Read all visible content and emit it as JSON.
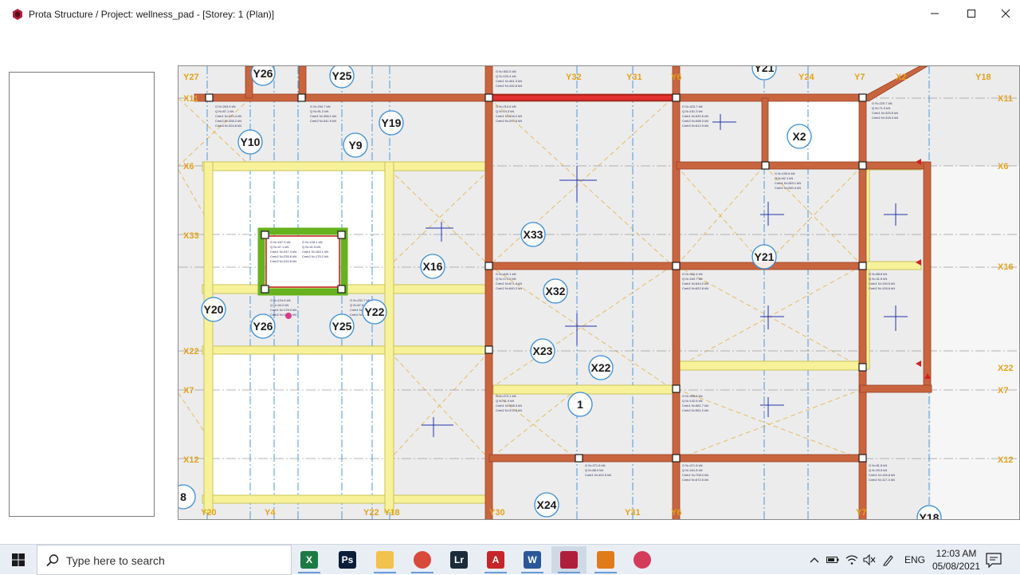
{
  "window": {
    "title": "Prota Structure / Project: wellness_pad - [Storey: 1 (Plan)]",
    "app_icon": "prota-structure-icon",
    "buttons": {
      "minimize": "minimize-icon",
      "maximize": "maximize-icon",
      "close": "close-icon"
    }
  },
  "plan": {
    "grid_labels": {
      "top": [
        "Y27",
        "Y24",
        "Y32",
        "Y31",
        "Y6",
        "Y24",
        "Y7",
        "X2",
        "Y18"
      ],
      "left": [
        "X11",
        "X6",
        "X33",
        "X22",
        "X7",
        "X12"
      ],
      "right": [
        "X11",
        "X6",
        "X16",
        "X22",
        "X7",
        "X12"
      ],
      "bottom": [
        "Y20",
        "Y4",
        "Y22",
        "Y18",
        "Y30",
        "Y31",
        "Y6",
        "Y7"
      ]
    },
    "column_markers": [
      "Y26",
      "Y25",
      "Y21",
      "Y19",
      "Y10",
      "Y9",
      "X2",
      "X33",
      "X16",
      "Y21",
      "X32",
      "Y20",
      "Y26",
      "Y25",
      "Y22",
      "X23",
      "X22",
      "1",
      "X24",
      "8",
      "Y18"
    ],
    "colors": {
      "beam_concrete": "#c8653f",
      "beam_edge": "#9a3f22",
      "slab_yellow": "#f7f29a",
      "slab_yellow_edge": "#c9c25a",
      "grid_dash": "#a0a0a0",
      "axis_orange": "#e3a21a",
      "selected_green": "#66b21e",
      "selected_red": "#c21818",
      "column_box": "#1a1a1a",
      "annotation_blue": "#2233aa",
      "background": "#ececec"
    }
  },
  "taskbar": {
    "search_placeholder": "Type here to search",
    "apps": [
      {
        "name": "excel",
        "letter": "X",
        "color": "#1d7a44"
      },
      {
        "name": "photoshop",
        "letter": "Ps",
        "color": "#0a1e3a"
      },
      {
        "name": "file-explorer",
        "letter": "",
        "color": "#f2c14e"
      },
      {
        "name": "chrome",
        "letter": "",
        "color": "#d84a3a"
      },
      {
        "name": "lightroom",
        "letter": "Lr",
        "color": "#1b2b3a"
      },
      {
        "name": "autocad",
        "letter": "A",
        "color": "#c6252a"
      },
      {
        "name": "word",
        "letter": "W",
        "color": "#2b579a"
      },
      {
        "name": "prota-structure",
        "letter": "",
        "color": "#b01f3a"
      },
      {
        "name": "hexagon-app",
        "letter": "",
        "color": "#e07b1a"
      },
      {
        "name": "image-app",
        "letter": "",
        "color": "#d33c5a"
      }
    ],
    "language": "ENG",
    "time": "12:03 AM",
    "date": "05/08/2021"
  }
}
